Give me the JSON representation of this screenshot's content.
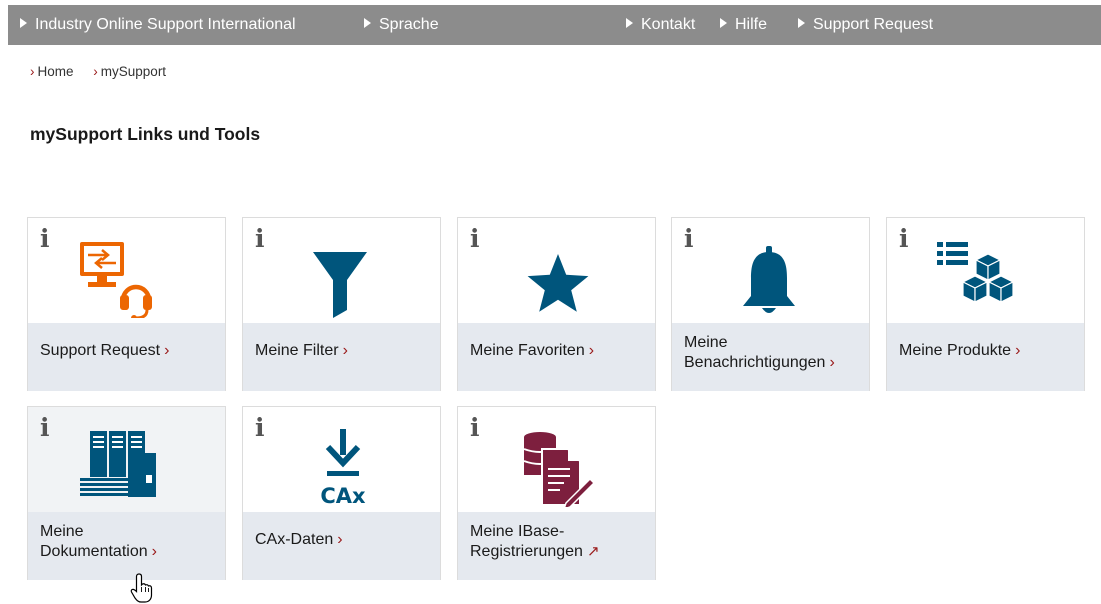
{
  "topnav": {
    "industry": "Industry Online Support International",
    "language": "Sprache",
    "contact": "Kontakt",
    "help": "Hilfe",
    "support_request": "Support Request"
  },
  "breadcrumb": {
    "home": "Home",
    "mysupport": "mySupport"
  },
  "page_title": "mySupport Links und Tools",
  "tile_info_glyph": "i",
  "tiles": [
    {
      "label": "Support Request",
      "icon": "support-request-icon",
      "link_type": "internal"
    },
    {
      "label": "Meine Filter",
      "icon": "filter-icon",
      "link_type": "internal"
    },
    {
      "label": "Meine Favoriten",
      "icon": "star-icon",
      "link_type": "internal"
    },
    {
      "label_line1": "Meine",
      "label_line2": "Benachrichtigungen",
      "icon": "bell-icon",
      "link_type": "internal"
    },
    {
      "label": "Meine Produkte",
      "icon": "products-icon",
      "link_type": "internal"
    },
    {
      "label_line1": "Meine",
      "label_line2": "Dokumentation",
      "icon": "documentation-icon",
      "link_type": "internal"
    },
    {
      "label": "CAx-Daten",
      "icon": "cax-download-icon",
      "icon_text": "CAx",
      "link_type": "internal"
    },
    {
      "label_line1": "Meine IBase-",
      "label_line2": "Registrierungen",
      "icon": "ibase-icon",
      "link_type": "external"
    }
  ],
  "colors": {
    "topbar": "#8c8c8c",
    "tile_label_bg": "#e5e9ef",
    "teal_icon": "#00557c",
    "orange_icon": "#ec6602",
    "maroon_icon": "#7d1f3e",
    "accent_arrow": "#9a1a1a"
  }
}
